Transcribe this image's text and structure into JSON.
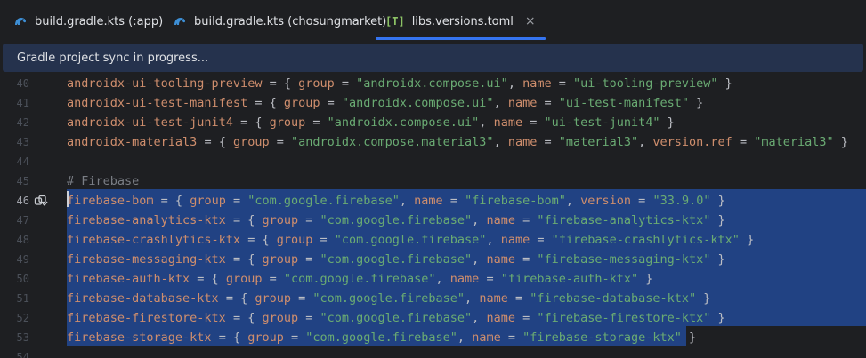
{
  "tabs": [
    {
      "label": "build.gradle.kts (:app)",
      "icon": "gradle-icon",
      "active": false
    },
    {
      "label": "build.gradle.kts (chosungmarket)",
      "icon": "gradle-icon",
      "active": false
    },
    {
      "label": "libs.versions.toml",
      "icon": "toml-icon",
      "icon_text": "[T]",
      "active": true,
      "close": "×"
    }
  ],
  "banner": {
    "text": "Gradle project sync in progress..."
  },
  "colors": {
    "accent": "#3574f0",
    "selection": "#214283",
    "key": "#cf8e6d",
    "string": "#6aab73",
    "comment": "#7a7e85"
  },
  "lines": [
    {
      "number": "40",
      "key": "androidx-ui-tooling-preview",
      "group": "androidx.compose.ui",
      "name": "ui-tooling-preview"
    },
    {
      "number": "41",
      "key": "androidx-ui-test-manifest",
      "group": "androidx.compose.ui",
      "name": "ui-test-manifest"
    },
    {
      "number": "42",
      "key": "androidx-ui-test-junit4",
      "group": "androidx.compose.ui",
      "name": "ui-test-junit4"
    },
    {
      "number": "43",
      "key": "androidx-material3",
      "group": "androidx.compose.material3",
      "name": "material3",
      "version_ref": "material3"
    },
    {
      "number": "44"
    },
    {
      "number": "45",
      "comment": "# Firebase"
    },
    {
      "number": "46",
      "key": "firebase-bom",
      "group": "com.google.firebase",
      "name": "firebase-bom",
      "version": "33.9.0",
      "current": true
    },
    {
      "number": "47",
      "key": "firebase-analytics-ktx",
      "group": "com.google.firebase",
      "name": "firebase-analytics-ktx"
    },
    {
      "number": "48",
      "key": "firebase-crashlytics-ktx",
      "group": "com.google.firebase",
      "name": "firebase-crashlytics-ktx"
    },
    {
      "number": "49",
      "key": "firebase-messaging-ktx",
      "group": "com.google.firebase",
      "name": "firebase-messaging-ktx"
    },
    {
      "number": "50",
      "key": "firebase-auth-ktx",
      "group": "com.google.firebase",
      "name": "firebase-auth-ktx"
    },
    {
      "number": "51",
      "key": "firebase-database-ktx",
      "group": "com.google.firebase",
      "name": "firebase-database-ktx"
    },
    {
      "number": "52",
      "key": "firebase-firestore-ktx",
      "group": "com.google.firebase",
      "name": "firebase-firestore-ktx"
    },
    {
      "number": "53",
      "key": "firebase-storage-ktx",
      "group": "com.google.firebase",
      "name": "firebase-storage-ktx"
    },
    {
      "number": "54"
    }
  ]
}
